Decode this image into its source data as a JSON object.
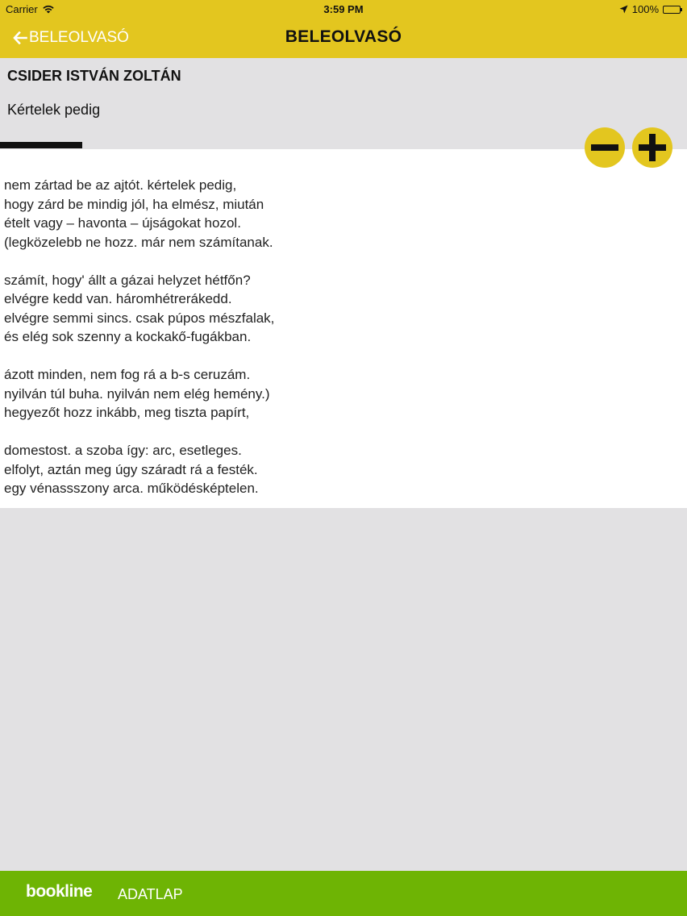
{
  "status_bar": {
    "carrier": "Carrier",
    "time": "3:59 PM",
    "battery": "100%"
  },
  "nav": {
    "back_label": "BELEOLVASÓ",
    "title": "BELEOLVASÓ"
  },
  "header": {
    "author": "CSIDER ISTVÁN ZOLTÁN",
    "title": "Kértelek pedig"
  },
  "poem": {
    "stanzas": [
      [
        "nem zártad be az ajtót. kértelek pedig,",
        "hogy zárd be mindig jól, ha elmész, miután",
        "ételt vagy – havonta – újságokat hozol.",
        "(legközelebb ne hozz. már nem számítanak."
      ],
      [
        "számít, hogy' állt a gázai helyzet hétfőn?",
        "elvégre kedd van. háromhétrerákedd.",
        "elvégre semmi sincs. csak púpos mészfalak,",
        "és elég sok szenny a kockakő-fugákban."
      ],
      [
        "ázott minden, nem fog rá a b-s ceruzám.",
        "nyilván túl buha. nyilván nem elég hemény.)",
        "hegyezőt hozz inkább, meg tiszta papírt,"
      ],
      [
        "domestost. a szoba így: arc, esetleges.",
        "elfolyt, aztán meg úgy száradt rá a festék.",
        "egy vénassszony arca. működésképtelen."
      ]
    ]
  },
  "bottom_bar": {
    "brand": "bookline",
    "datasheet_label": "ADATLAP"
  },
  "icons": {
    "back": "arrow-left-icon",
    "zoom_out": "minus-icon",
    "zoom_in": "plus-icon",
    "wifi": "wifi-icon",
    "location": "location-arrow-icon",
    "battery": "battery-icon"
  },
  "colors": {
    "accent_yellow": "#e3c61f",
    "bottom_green": "#6eb404",
    "background_gray": "#e2e1e3"
  },
  "reading_progress": 0.12
}
